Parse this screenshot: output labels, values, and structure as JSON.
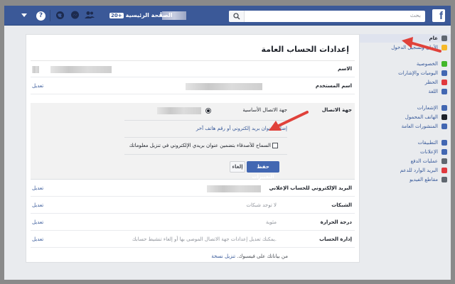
{
  "topbar": {
    "logo": "f",
    "search_placeholder": "بحث",
    "home_label": "الصفحة الرئيسية",
    "home_badge": "20+",
    "profile_initial": "I"
  },
  "sidebar": {
    "items": [
      {
        "label": "عام",
        "icon": "gear-icon",
        "color": "#606770",
        "active": true
      },
      {
        "label": "الأمان وتسجيل الدخول",
        "icon": "shield-icon",
        "color": "#f7b928"
      },
      {
        "label": "الخصوصية",
        "icon": "lock-icon",
        "color": "#42b72a"
      },
      {
        "label": "اليوميات والإشارات",
        "icon": "timeline-icon",
        "color": "#4267b2"
      },
      {
        "label": "الحظر",
        "icon": "block-icon",
        "color": "#e0393e"
      },
      {
        "label": "اللغة",
        "icon": "language-icon",
        "color": "#4267b2"
      },
      {
        "label": "الإشعارات",
        "icon": "globe-icon",
        "color": "#4267b2"
      },
      {
        "label": "الهاتف المحمول",
        "icon": "mobile-icon",
        "color": "#1d2129"
      },
      {
        "label": "المنشورات العامة",
        "icon": "rss-icon",
        "color": "#4267b2"
      },
      {
        "label": "التطبيقات",
        "icon": "apps-icon",
        "color": "#4267b2"
      },
      {
        "label": "الإعلانات",
        "icon": "ads-icon",
        "color": "#4267b2"
      },
      {
        "label": "عمليات الدفع",
        "icon": "card-icon",
        "color": "#606770"
      },
      {
        "label": "البريد الوارد للدعم",
        "icon": "lifebuoy-icon",
        "color": "#e0393e"
      },
      {
        "label": "مقاطع الفيديو",
        "icon": "film-icon",
        "color": "#606770"
      }
    ]
  },
  "main": {
    "title": "إعدادات الحساب العامة",
    "rows": {
      "name": {
        "label": "الاسم"
      },
      "username": {
        "label": "اسم المستخدم",
        "edit": "تعديل"
      },
      "contact": {
        "label": "جهة الاتصال",
        "primary_label": "جهة الاتصال الأساسية",
        "add_link": "إضافة عنوان بريد إلكتروني أو رقم هاتف آخر",
        "allow_checkbox": "السماح للأصدقاء بتضمين عنوان بريدي الإلكتروني في تنزيل معلوماتك",
        "save_button": "حفظ التغييرات",
        "cancel_button": "إلغاء"
      },
      "ad_email": {
        "label": "البريد الإلكتروني للحساب الإعلاني",
        "edit": "تعديل"
      },
      "networks": {
        "label": "الشبكات",
        "value": "لا توجد شبكات",
        "edit": "تعديل"
      },
      "temperature": {
        "label": "درجة الحرارة",
        "value": "مئوية",
        "edit": "تعديل"
      },
      "manage": {
        "label": "إدارة الحساب",
        "value": "يمكنك تعديل إعدادات جهة الاتصال الموصى بها أو إلغاء تنشيط حسابك.",
        "edit": "تعديل"
      }
    },
    "footer_link": "تنزيل نسخة",
    "footer_text": "من بياناتك على فيسبوك."
  },
  "colors": {
    "brand": "#3b5998",
    "annotation_arrow": "#e0413a"
  }
}
